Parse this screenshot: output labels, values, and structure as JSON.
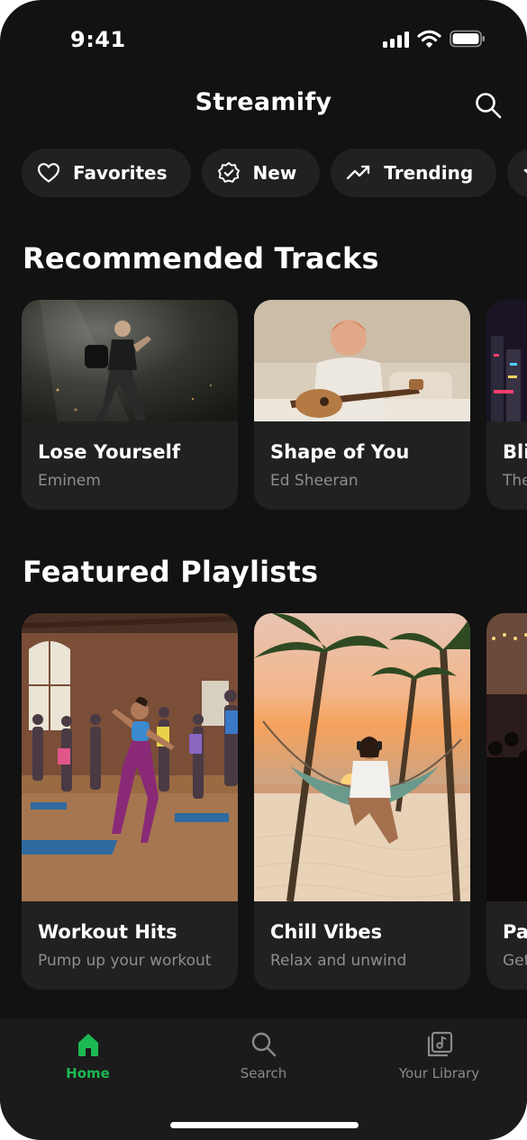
{
  "status_bar": {
    "time": "9:41"
  },
  "header": {
    "title": "Streamify",
    "search_icon": "search-icon"
  },
  "chips": [
    {
      "label": "Favorites",
      "icon": "heart-icon"
    },
    {
      "label": "New",
      "icon": "badge-check-icon"
    },
    {
      "label": "Trending",
      "icon": "trending-up-icon"
    },
    {
      "label": "",
      "icon": "star-icon"
    }
  ],
  "recommended": {
    "title": "Recommended Tracks",
    "tracks": [
      {
        "title": "Lose Yourself",
        "artist": "Eminem"
      },
      {
        "title": "Shape of You",
        "artist": "Ed Sheeran"
      },
      {
        "title": "Bli",
        "artist": "The"
      }
    ]
  },
  "featured": {
    "title": "Featured Playlists",
    "playlists": [
      {
        "title": "Workout Hits",
        "subtitle": "Pump up your workout"
      },
      {
        "title": "Chill Vibes",
        "subtitle": "Relax and unwind"
      },
      {
        "title": "Pa",
        "subtitle": "Get"
      }
    ]
  },
  "bottom_nav": {
    "items": [
      {
        "label": "Home",
        "icon": "home-icon",
        "active": true
      },
      {
        "label": "Search",
        "icon": "search-icon",
        "active": false
      },
      {
        "label": "Your Library",
        "icon": "library-icon",
        "active": false
      }
    ]
  },
  "colors": {
    "background": "#121212",
    "card": "#212121",
    "accent": "#1db954",
    "muted_text": "#8e8e8e"
  }
}
